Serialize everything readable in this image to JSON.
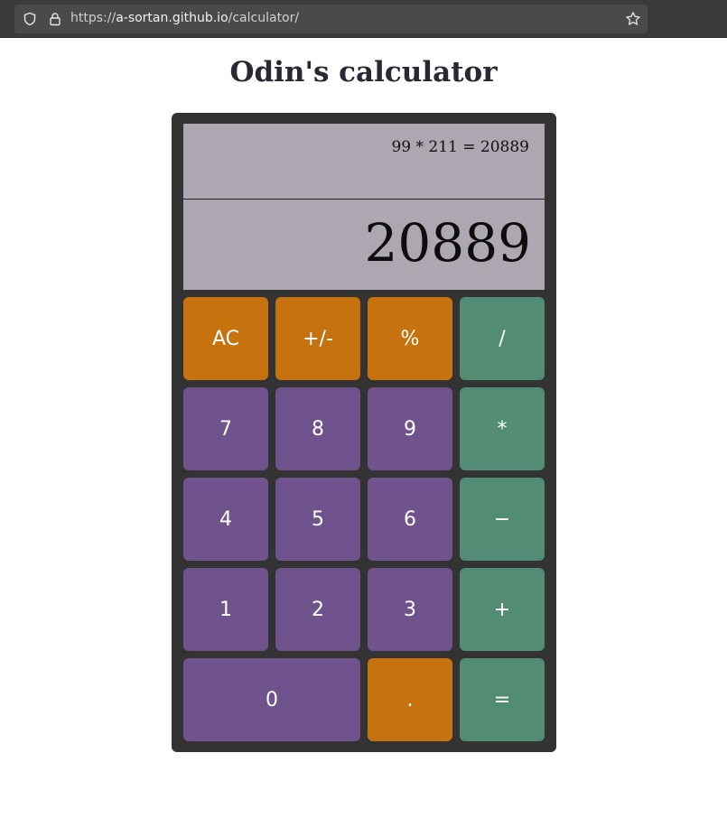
{
  "browser": {
    "url_scheme": "https://",
    "url_host": "a-sortan.github.io",
    "url_path": "/calculator/",
    "icons": [
      "shield-icon",
      "lock-icon",
      "star-icon"
    ]
  },
  "page": {
    "title": "Odin's calculator"
  },
  "display": {
    "history": "99 * 211 = 20889",
    "current": "20889"
  },
  "keys": {
    "ac": "AC",
    "sign": "+/-",
    "percent": "%",
    "divide": "/",
    "seven": "7",
    "eight": "8",
    "nine": "9",
    "multiply": "*",
    "four": "4",
    "five": "5",
    "six": "6",
    "subtract": "−",
    "one": "1",
    "two": "2",
    "three": "3",
    "add": "+",
    "zero": "0",
    "decimal": ".",
    "equals": "="
  },
  "colors": {
    "function_key": "#c5720f",
    "digit_key": "#70528c",
    "operator_key": "#528c75",
    "display_bg": "#ada7b1",
    "body_bg": "#333333"
  }
}
